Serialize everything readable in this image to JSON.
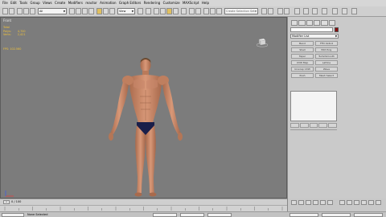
{
  "menu": [
    "File",
    "Edit",
    "Tools",
    "Group",
    "Views",
    "Create",
    "Modifiers",
    "reactor",
    "Animation",
    "Graph Editors",
    "Rendering",
    "Customize",
    "MAXScript",
    "Help"
  ],
  "toolbar": {
    "selection_filter": "All",
    "view_dropdown": "View",
    "selection_set": "Create Selection Set"
  },
  "viewport": {
    "label": "Front",
    "stats": [
      {
        "label": "Total",
        "value": ""
      },
      {
        "label": "Polys:",
        "value": "4,700"
      },
      {
        "label": "Verts:",
        "value": "2,421"
      }
    ],
    "fps_label": "FPS:",
    "fps_value": "102.560"
  },
  "command_panel": {
    "modifier_list": "Modifier List",
    "buttons": [
      "Bend",
      "FFD 4x4x4",
      "Shell",
      "Edit Poly",
      "Taper",
      "TurboSmooth",
      "UVW Map",
      "Lattice",
      "Unwrap UVW",
      "Wave",
      "Push",
      "Mesh Select"
    ]
  },
  "time": {
    "counter": "0 / 100"
  },
  "status": {
    "message": "None Selected"
  },
  "colors": {
    "viewport_bg": "#7c7c7c",
    "stats_text": "#f0c23a",
    "object_color": "#8a1010"
  }
}
